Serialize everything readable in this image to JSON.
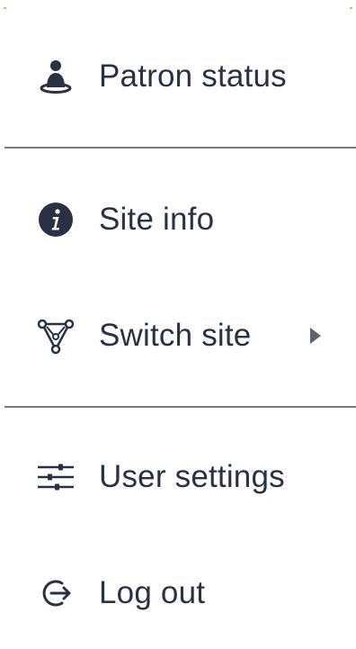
{
  "menu": {
    "items": [
      {
        "label": "Patron status",
        "icon": "patron-user-icon"
      },
      {
        "label": "Site info",
        "icon": "info-icon"
      },
      {
        "label": "Switch site",
        "icon": "network-triangle-icon",
        "has_submenu": true
      },
      {
        "label": "User settings",
        "icon": "sliders-icon"
      },
      {
        "label": "Log out",
        "icon": "logout-icon"
      }
    ]
  },
  "colors": {
    "text": "#2b3145",
    "icon": "#2b3145",
    "divider": "#7a7a7a",
    "chevron": "#5e6270"
  }
}
